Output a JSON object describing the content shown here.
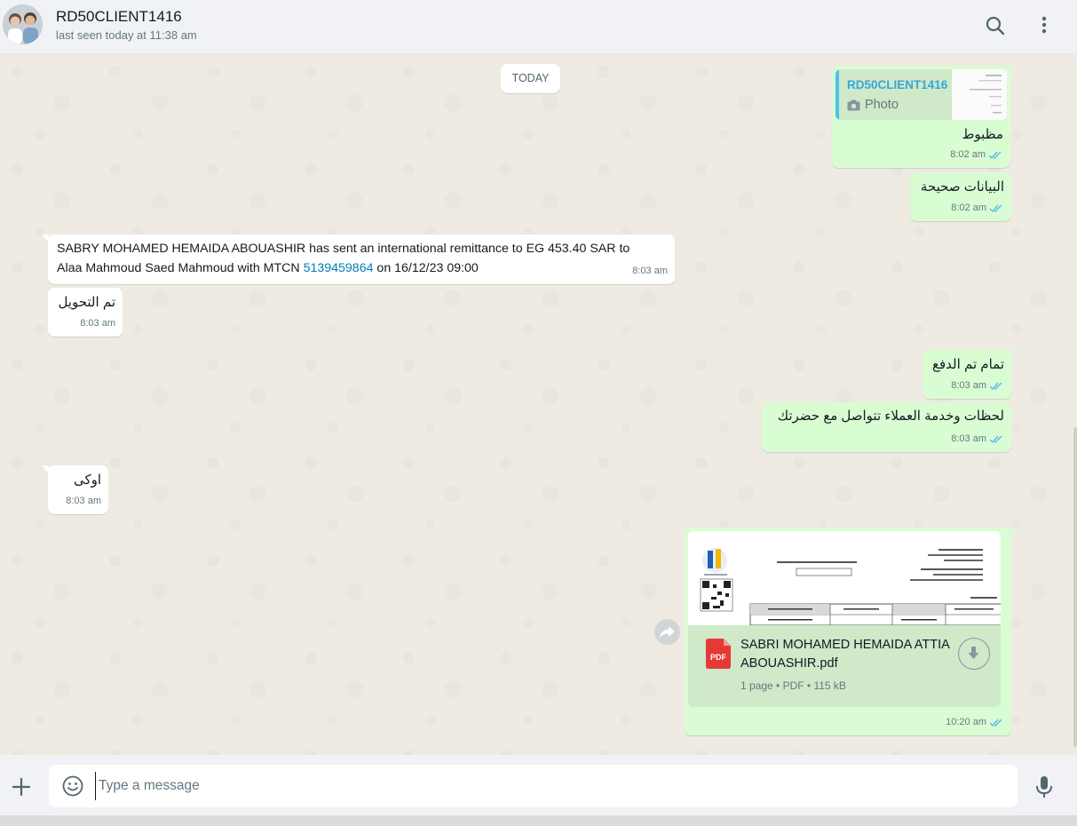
{
  "header": {
    "contact_name": "RD50CLIENT1416",
    "status": "last seen today at 11:38 am",
    "search_icon": "search-icon",
    "menu_icon": "kebab-menu-icon"
  },
  "chat": {
    "date_divider": "TODAY",
    "messages": [
      {
        "direction": "out",
        "quote_author": "RD50CLIENT1416",
        "quote_type": "Photo",
        "text": "مظبوط",
        "time": "8:02 am",
        "status": "read"
      },
      {
        "direction": "out",
        "text": "البيانات صحيحة",
        "time": "8:02 am",
        "status": "read"
      },
      {
        "direction": "in",
        "text_line1": "SABRY MOHAMED HEMAIDA ABOUASHIR has sent an international remittance to EG 453.40 SAR to",
        "text_line2_prefix": "Alaa Mahmoud Saed Mahmoud with MTCN ",
        "mtcn": "5139459864",
        "text_line2_suffix": " on 16/12/23 09:00",
        "time": "8:03 am"
      },
      {
        "direction": "in",
        "text": "تم التحويل",
        "time": "8:03 am"
      },
      {
        "direction": "out",
        "text": "تمام تم الدفع",
        "time": "8:03 am",
        "status": "read"
      },
      {
        "direction": "out",
        "text": "لحظات وخدمة العملاء تتواصل مع حضرتك",
        "time": "8:03 am",
        "status": "read"
      },
      {
        "direction": "in",
        "text": "اوكى",
        "time": "8:03 am"
      },
      {
        "direction": "out",
        "type": "document",
        "file_name": "SABRI MOHAMED HEMAIDA ATTIA ABOUASHIR.pdf",
        "file_info": "1 page • PDF • 115 kB",
        "file_badge": "PDF",
        "time": "10:20 am",
        "status": "read"
      }
    ]
  },
  "composer": {
    "placeholder": "Type a message"
  },
  "colors": {
    "outgoing_bubble": "#d9fdd3",
    "incoming_bubble": "#ffffff",
    "read_ticks": "#53bdeb",
    "link": "#027eb5",
    "chat_background": "#efeae2"
  }
}
